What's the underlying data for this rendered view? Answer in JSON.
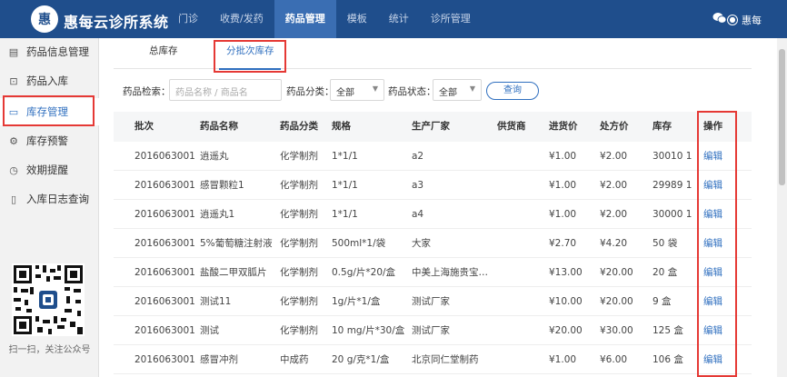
{
  "header": {
    "logo_glyph": "惠",
    "brand": "惠每云诊所系统",
    "nav": [
      "门诊",
      "收费/发药",
      "药品管理",
      "模板",
      "统计",
      "诊所管理"
    ],
    "active_nav": 2,
    "user": "惠每",
    "wechat_icon": "wechat-icon",
    "user_icon": "user-icon"
  },
  "sidebar": {
    "items": [
      {
        "icon": "▤",
        "label": "药品信息管理"
      },
      {
        "icon": "⊡",
        "label": "药品入库"
      },
      {
        "icon": "▭",
        "label": "库存管理"
      },
      {
        "icon": "⚙",
        "label": "库存预警"
      },
      {
        "icon": "◷",
        "label": "效期提醒"
      },
      {
        "icon": "▯",
        "label": "入库日志查询"
      }
    ],
    "active": 2,
    "qr_caption": "扫一扫，关注公众号"
  },
  "tabs": [
    "总库存",
    "分批次库存"
  ],
  "active_tab": 1,
  "filters": {
    "drug_label": "药品检索：",
    "drug_placeholder": "药品名称 / 商品名",
    "category_label": "药品分类：",
    "category_value": "全部",
    "status_label": "药品状态：",
    "status_value": "全部",
    "search_button": "查询"
  },
  "table": {
    "columns": [
      "批次",
      "药品名称",
      "药品分类",
      "规格",
      "生产厂家",
      "供货商",
      "进货价",
      "处方价",
      "库存",
      "操作"
    ],
    "rows": [
      [
        "2016063001",
        "逍遥丸",
        "化学制剂",
        "1*1/1",
        "a2",
        "",
        "¥1.00",
        "¥2.00",
        "30010 1",
        "编辑"
      ],
      [
        "2016063001",
        "感冒颗粒1",
        "化学制剂",
        "1*1/1",
        "a3",
        "",
        "¥1.00",
        "¥2.00",
        "29989 1",
        "编辑"
      ],
      [
        "2016063001",
        "逍遥丸1",
        "化学制剂",
        "1*1/1",
        "a4",
        "",
        "¥1.00",
        "¥2.00",
        "30000 1",
        "编辑"
      ],
      [
        "2016063001",
        "5%葡萄糖注射液",
        "化学制剂",
        "500ml*1/袋",
        "大家",
        "",
        "¥2.70",
        "¥4.20",
        "50 袋",
        "编辑"
      ],
      [
        "2016063001",
        "盐酸二甲双胍片",
        "化学制剂",
        "0.5g/片*20/盒",
        "中美上海施贵宝…",
        "",
        "¥13.00",
        "¥20.00",
        "20 盒",
        "编辑"
      ],
      [
        "2016063001",
        "测试11",
        "化学制剂",
        "1g/片*1/盒",
        "测试厂家",
        "",
        "¥10.00",
        "¥20.00",
        "9 盒",
        "编辑"
      ],
      [
        "2016063001",
        "测试",
        "化学制剂",
        "10 mg/片*30/盒",
        "测试厂家",
        "",
        "¥20.00",
        "¥30.00",
        "125 盒",
        "编辑"
      ],
      [
        "2016063001",
        "感冒冲剂",
        "中成药",
        "20 g/克*1/盒",
        "北京同仁堂制药",
        "",
        "¥1.00",
        "¥6.00",
        "106 盒",
        "编辑"
      ]
    ]
  },
  "colors": {
    "topbar": "#1f4e8c",
    "accent": "#2f6fbf",
    "highlight": "#e53935"
  }
}
